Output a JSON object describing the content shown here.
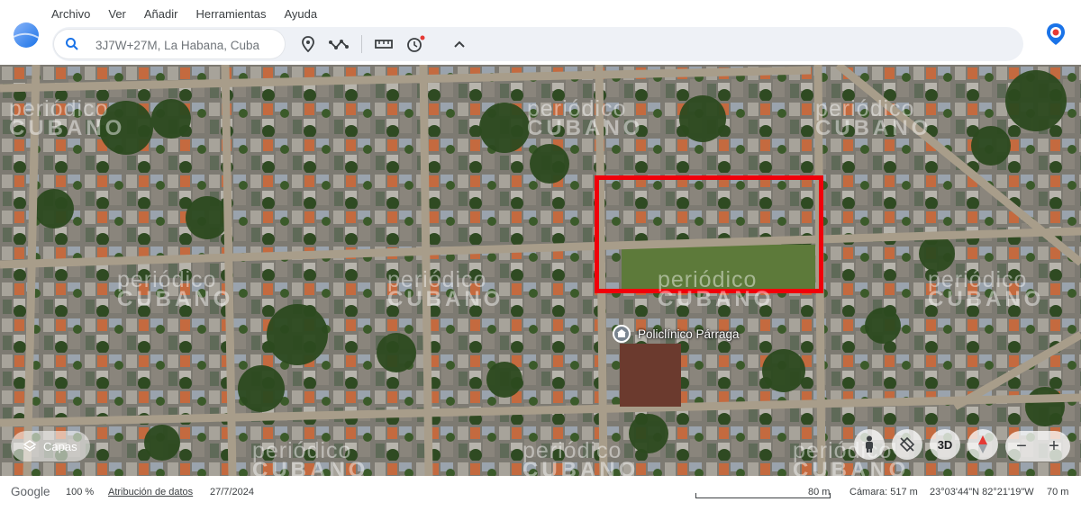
{
  "menu": {
    "items": [
      "Archivo",
      "Ver",
      "Añadir",
      "Herramientas",
      "Ayuda"
    ]
  },
  "search": {
    "value": "3J7W+27M, La Habana, Cuba"
  },
  "toolbar": {
    "icons": [
      "search-icon",
      "place-pin-icon",
      "path-icon",
      "ruler-icon",
      "history-icon",
      "collapse-chevron-icon"
    ]
  },
  "map": {
    "watermark_line1": "periódico",
    "watermark_line2": "CUBANO",
    "poi_label": "Policlínico Párraga",
    "highlight_color": "#f0000a"
  },
  "controls": {
    "layers_label": "Capas",
    "view_3d_label": "3D",
    "zoom_out": "−",
    "zoom_in": "+"
  },
  "status": {
    "brand": "Google",
    "zoom": "100 %",
    "attribution": "Atribución de datos",
    "date": "27/7/2024",
    "scale": "80 m",
    "camera": "Cámara: 517 m",
    "coords": "23°03'44\"N 82°21'19\"W",
    "elevation": "70 m"
  }
}
